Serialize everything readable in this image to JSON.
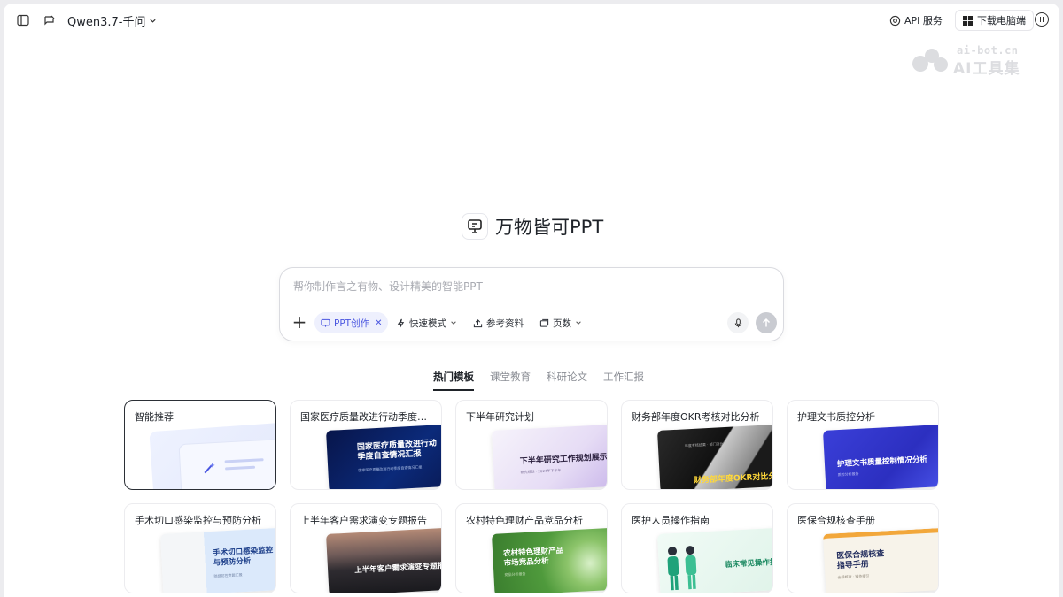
{
  "topbar": {
    "model_name": "Qwen3.7-千问",
    "api_label": "API 服务",
    "download_label": "下载电脑端"
  },
  "watermark": {
    "url": "ai-bot.cn",
    "text": "AI工具集"
  },
  "hero": {
    "title": "万物皆可PPT"
  },
  "composer": {
    "placeholder": "帮你制作言之有物、设计精美的智能PPT",
    "chip_label": "PPT创作",
    "quick_mode": "快速模式",
    "reference": "参考资料",
    "pages": "页数"
  },
  "tabs": [
    "热门模板",
    "课堂教育",
    "科研论文",
    "工作汇报"
  ],
  "templates": [
    {
      "title": "智能推荐"
    },
    {
      "title": "国家医疗质量改进行动季度自...",
      "cover_text": "国家医疗质量改进行动\n季度自查情况汇报",
      "cover_sub": "国家医疗质量改进行动季度自查情况汇报"
    },
    {
      "title": "下半年研究计划",
      "cover_text": "下半年研究工作规划展示",
      "cover_sub": "研究规划 · 2024年下半年"
    },
    {
      "title": "财务部年度OKR考核对比分析",
      "cover_text": "财务部年度OKR对比分析",
      "cover_sub": "年度考核结果 · 部门对比"
    },
    {
      "title": "护理文书质控分析",
      "cover_text": "护理文书质量控制情况分析",
      "cover_sub": "质控分析报告"
    },
    {
      "title": "手术切口感染监控与预防分析",
      "cover_text": "手术切口感染监控\n与预防分析",
      "cover_sub": "院感防控专题汇报"
    },
    {
      "title": "上半年客户需求演变专题报告",
      "cover_text": "上半年客户需求演变专题报告",
      "cover_sub": ""
    },
    {
      "title": "农村特色理财产品竞品分析",
      "cover_text": "农村特色理财产品\n市场竞品分析",
      "cover_sub": "竞品分析报告"
    },
    {
      "title": "医护人员操作指南",
      "cover_text": "临床常见操作指",
      "cover_sub": ""
    },
    {
      "title": "医保合规核查手册",
      "cover_text": "医保合规核查\n指导手册",
      "cover_sub": "合规核查 · 操作指引"
    }
  ]
}
